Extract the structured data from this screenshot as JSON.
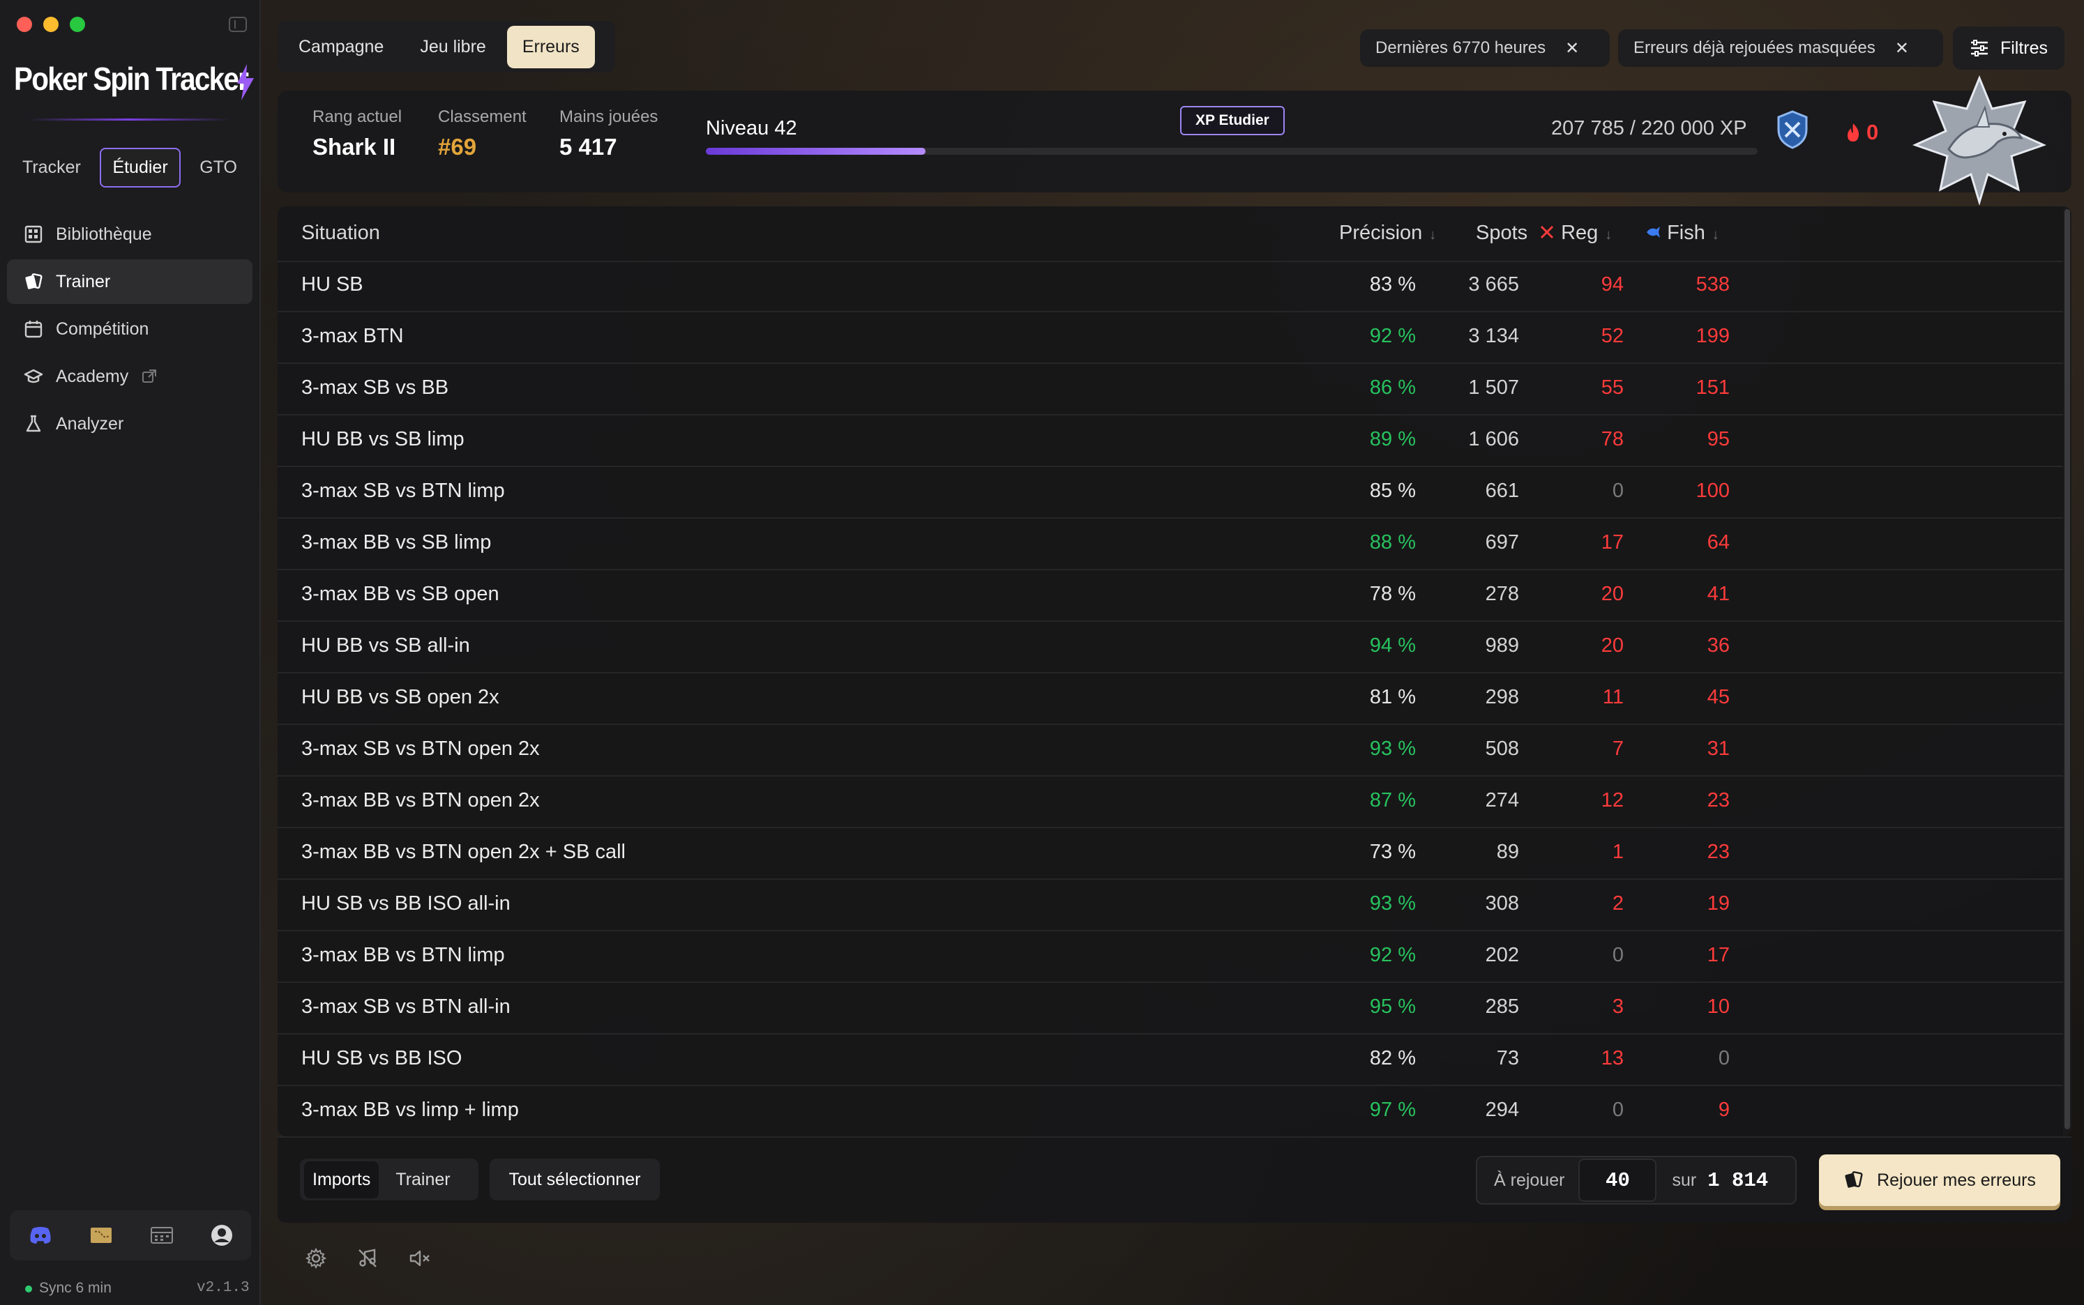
{
  "app": {
    "logo_text": "Poker Spin Tracker",
    "mode_tabs": [
      {
        "label": "Tracker",
        "active": false
      },
      {
        "label": "Étudier",
        "active": true
      },
      {
        "label": "GTO",
        "active": false
      }
    ]
  },
  "sidebar": {
    "items": [
      {
        "label": "Bibliothèque",
        "icon": "library-icon",
        "active": false
      },
      {
        "label": "Trainer",
        "icon": "cards-icon",
        "active": true
      },
      {
        "label": "Compétition",
        "icon": "calendar-icon",
        "active": false
      },
      {
        "label": "Academy",
        "icon": "graduation-cap-icon",
        "active": false
      },
      {
        "label": "Analyzer",
        "icon": "flask-icon",
        "active": false
      }
    ],
    "bottom_icons": [
      "discord-icon",
      "map-icon",
      "calendar-grid-icon",
      "account-icon"
    ],
    "sync": "Sync 6 min",
    "version": "v2.1.3"
  },
  "header": {
    "tabs": [
      {
        "label": "Campagne",
        "active": false
      },
      {
        "label": "Jeu libre",
        "active": false
      },
      {
        "label": "Erreurs",
        "active": true
      }
    ],
    "chips": [
      {
        "label": "Dernières 6770 heures"
      },
      {
        "label": "Erreurs déjà rejouées masquées"
      }
    ],
    "filters_label": "Filtres"
  },
  "stats": {
    "rank_label": "Rang actuel",
    "rank_value": "Shark II",
    "classement_label": "Classement",
    "classement_value": "#69",
    "hands_label": "Mains jouées",
    "hands_value": "5 417",
    "level_label": "Niveau 42",
    "xp_badge": "XP Etudier",
    "xp_text": "207 785 / 220 000 XP",
    "xp_progress": 0.209,
    "streak": "0"
  },
  "table": {
    "headers": {
      "situation": "Situation",
      "precision": "Précision",
      "spots": "Spots",
      "reg": "Reg",
      "fish": "Fish"
    },
    "rows": [
      {
        "situation": "HU SB",
        "precision": "83 %",
        "spots": "3 665",
        "reg": "94",
        "fish": "538"
      },
      {
        "situation": "3-max BTN",
        "precision": "92 %",
        "spots": "3 134",
        "reg": "52",
        "fish": "199"
      },
      {
        "situation": "3-max SB vs BB",
        "precision": "86 %",
        "spots": "1 507",
        "reg": "55",
        "fish": "151"
      },
      {
        "situation": "HU BB vs SB limp",
        "precision": "89 %",
        "spots": "1 606",
        "reg": "78",
        "fish": "95"
      },
      {
        "situation": "3-max SB vs BTN limp",
        "precision": "85 %",
        "spots": "661",
        "reg": "0",
        "fish": "100"
      },
      {
        "situation": "3-max BB vs SB limp",
        "precision": "88 %",
        "spots": "697",
        "reg": "17",
        "fish": "64"
      },
      {
        "situation": "3-max BB vs SB open",
        "precision": "78 %",
        "spots": "278",
        "reg": "20",
        "fish": "41"
      },
      {
        "situation": "HU BB vs SB all-in",
        "precision": "94 %",
        "spots": "989",
        "reg": "20",
        "fish": "36"
      },
      {
        "situation": "HU BB vs SB open 2x",
        "precision": "81 %",
        "spots": "298",
        "reg": "11",
        "fish": "45"
      },
      {
        "situation": "3-max SB vs BTN open 2x",
        "precision": "93 %",
        "spots": "508",
        "reg": "7",
        "fish": "31"
      },
      {
        "situation": "3-max BB vs BTN open 2x",
        "precision": "87 %",
        "spots": "274",
        "reg": "12",
        "fish": "23"
      },
      {
        "situation": "3-max BB vs BTN open 2x + SB call",
        "precision": "73 %",
        "spots": "89",
        "reg": "1",
        "fish": "23"
      },
      {
        "situation": "HU SB vs BB ISO all-in",
        "precision": "93 %",
        "spots": "308",
        "reg": "2",
        "fish": "19"
      },
      {
        "situation": "3-max BB vs BTN limp",
        "precision": "92 %",
        "spots": "202",
        "reg": "0",
        "fish": "17"
      },
      {
        "situation": "3-max SB vs BTN all-in",
        "precision": "95 %",
        "spots": "285",
        "reg": "3",
        "fish": "10"
      },
      {
        "situation": "HU SB vs BB ISO",
        "precision": "82 %",
        "spots": "73",
        "reg": "13",
        "fish": "0"
      },
      {
        "situation": "3-max BB vs limp + limp",
        "precision": "97 %",
        "spots": "294",
        "reg": "0",
        "fish": "9"
      }
    ]
  },
  "footer": {
    "seg_options": [
      {
        "label": "Imports",
        "active": true
      },
      {
        "label": "Trainer",
        "active": false
      }
    ],
    "select_all": "Tout sélectionner",
    "replay_label": "À rejouer",
    "replay_value": "40",
    "replay_sur": "sur",
    "replay_total": "1 814",
    "replay_button": "Rejouer mes erreurs"
  },
  "bottom_bar": {
    "icons": [
      "settings-icon",
      "music-muted-icon",
      "volume-muted-icon"
    ]
  },
  "colors": {
    "accent_purple": "#8d6ef0",
    "good_green": "#27c25e",
    "error_red": "#ff3b3b",
    "gold": "#e3a53a",
    "button_cream": "#f4e6c6"
  }
}
